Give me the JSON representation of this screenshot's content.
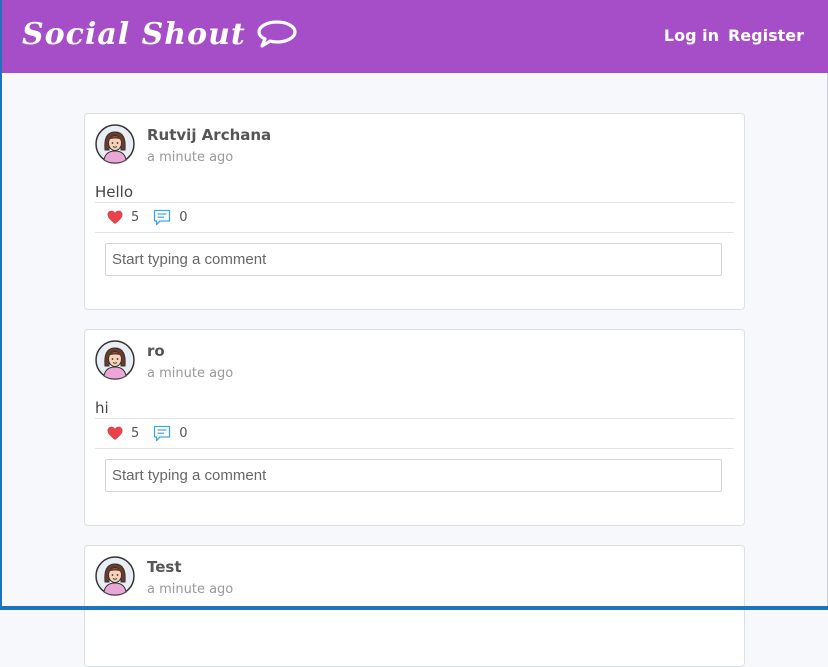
{
  "navbar": {
    "brand": "Social Shout",
    "brand_icon": "speech-bubble-icon",
    "background": "#a64dc8",
    "login_label": "Log in",
    "register_label": "Register"
  },
  "posts": [
    {
      "author": "Rutvij Archana",
      "time": "a minute ago",
      "text": "Hello",
      "likes": "5",
      "comments": "0",
      "comment_placeholder": "Start typing a comment"
    },
    {
      "author": "ro",
      "time": "a minute ago",
      "text": "hi",
      "likes": "5",
      "comments": "0",
      "comment_placeholder": "Start typing a comment"
    },
    {
      "author": "Test",
      "time": "a minute ago"
    }
  ],
  "icons": {
    "like": "heart-icon",
    "comment": "comment-icon",
    "avatar": "avatar"
  },
  "colors": {
    "like": "#e8434a",
    "comment": "#3ea6e8"
  }
}
